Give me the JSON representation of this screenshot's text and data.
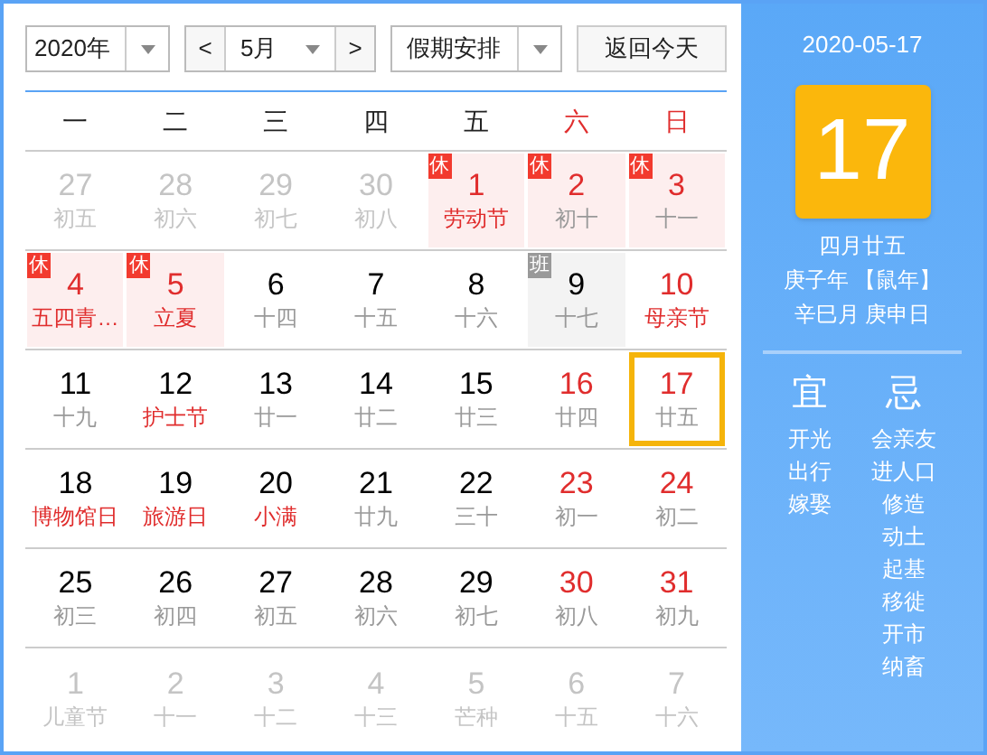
{
  "toolbar": {
    "year": "2020年",
    "month": "5月",
    "prev": "<",
    "next": ">",
    "holiday_select": "假期安排",
    "today_button": "返回今天"
  },
  "weekdays": [
    {
      "label": "一",
      "weekend": false
    },
    {
      "label": "二",
      "weekend": false
    },
    {
      "label": "三",
      "weekend": false
    },
    {
      "label": "四",
      "weekend": false
    },
    {
      "label": "五",
      "weekend": false
    },
    {
      "label": "六",
      "weekend": true
    },
    {
      "label": "日",
      "weekend": true
    }
  ],
  "days": [
    {
      "day": "27",
      "lunar": "初五",
      "kind": "muted",
      "festival": false,
      "selected": false
    },
    {
      "day": "28",
      "lunar": "初六",
      "kind": "muted",
      "festival": false,
      "selected": false
    },
    {
      "day": "29",
      "lunar": "初七",
      "kind": "muted",
      "festival": false,
      "selected": false
    },
    {
      "day": "30",
      "lunar": "初八",
      "kind": "muted",
      "festival": false,
      "selected": false
    },
    {
      "day": "1",
      "lunar": "劳动节",
      "kind": "red",
      "festival": true,
      "selected": false,
      "badge": {
        "kind": "rest",
        "text": "休"
      }
    },
    {
      "day": "2",
      "lunar": "初十",
      "kind": "red",
      "festival": false,
      "selected": false,
      "badge": {
        "kind": "rest",
        "text": "休"
      }
    },
    {
      "day": "3",
      "lunar": "十一",
      "kind": "red",
      "festival": false,
      "selected": false,
      "badge": {
        "kind": "rest",
        "text": "休"
      }
    },
    {
      "day": "4",
      "lunar": "五四青…",
      "kind": "red",
      "festival": true,
      "selected": false,
      "badge": {
        "kind": "rest",
        "text": "休"
      }
    },
    {
      "day": "5",
      "lunar": "立夏",
      "kind": "red",
      "festival": true,
      "selected": false,
      "badge": {
        "kind": "rest",
        "text": "休"
      }
    },
    {
      "day": "6",
      "lunar": "十四",
      "kind": "normal",
      "festival": false,
      "selected": false
    },
    {
      "day": "7",
      "lunar": "十五",
      "kind": "normal",
      "festival": false,
      "selected": false
    },
    {
      "day": "8",
      "lunar": "十六",
      "kind": "normal",
      "festival": false,
      "selected": false
    },
    {
      "day": "9",
      "lunar": "十七",
      "kind": "normal",
      "festival": false,
      "selected": false,
      "badge": {
        "kind": "work",
        "text": "班"
      }
    },
    {
      "day": "10",
      "lunar": "母亲节",
      "kind": "red",
      "festival": true,
      "selected": false
    },
    {
      "day": "11",
      "lunar": "十九",
      "kind": "normal",
      "festival": false,
      "selected": false
    },
    {
      "day": "12",
      "lunar": "护士节",
      "kind": "normal",
      "festival": true,
      "selected": false
    },
    {
      "day": "13",
      "lunar": "廿一",
      "kind": "normal",
      "festival": false,
      "selected": false
    },
    {
      "day": "14",
      "lunar": "廿二",
      "kind": "normal",
      "festival": false,
      "selected": false
    },
    {
      "day": "15",
      "lunar": "廿三",
      "kind": "normal",
      "festival": false,
      "selected": false
    },
    {
      "day": "16",
      "lunar": "廿四",
      "kind": "red",
      "festival": false,
      "selected": false
    },
    {
      "day": "17",
      "lunar": "廿五",
      "kind": "red",
      "festival": false,
      "selected": true
    },
    {
      "day": "18",
      "lunar": "博物馆日",
      "kind": "normal",
      "festival": true,
      "selected": false
    },
    {
      "day": "19",
      "lunar": "旅游日",
      "kind": "normal",
      "festival": true,
      "selected": false
    },
    {
      "day": "20",
      "lunar": "小满",
      "kind": "normal",
      "festival": true,
      "selected": false
    },
    {
      "day": "21",
      "lunar": "廿九",
      "kind": "normal",
      "festival": false,
      "selected": false
    },
    {
      "day": "22",
      "lunar": "三十",
      "kind": "normal",
      "festival": false,
      "selected": false
    },
    {
      "day": "23",
      "lunar": "初一",
      "kind": "red",
      "festival": false,
      "selected": false
    },
    {
      "day": "24",
      "lunar": "初二",
      "kind": "red",
      "festival": false,
      "selected": false
    },
    {
      "day": "25",
      "lunar": "初三",
      "kind": "normal",
      "festival": false,
      "selected": false
    },
    {
      "day": "26",
      "lunar": "初四",
      "kind": "normal",
      "festival": false,
      "selected": false
    },
    {
      "day": "27",
      "lunar": "初五",
      "kind": "normal",
      "festival": false,
      "selected": false
    },
    {
      "day": "28",
      "lunar": "初六",
      "kind": "normal",
      "festival": false,
      "selected": false
    },
    {
      "day": "29",
      "lunar": "初七",
      "kind": "normal",
      "festival": false,
      "selected": false
    },
    {
      "day": "30",
      "lunar": "初八",
      "kind": "red",
      "festival": false,
      "selected": false
    },
    {
      "day": "31",
      "lunar": "初九",
      "kind": "red",
      "festival": false,
      "selected": false
    },
    {
      "day": "1",
      "lunar": "儿童节",
      "kind": "muted",
      "festival": false,
      "selected": false
    },
    {
      "day": "2",
      "lunar": "十一",
      "kind": "muted",
      "festival": false,
      "selected": false
    },
    {
      "day": "3",
      "lunar": "十二",
      "kind": "muted",
      "festival": false,
      "selected": false
    },
    {
      "day": "4",
      "lunar": "十三",
      "kind": "muted",
      "festival": false,
      "selected": false
    },
    {
      "day": "5",
      "lunar": "芒种",
      "kind": "muted",
      "festival": false,
      "selected": false
    },
    {
      "day": "6",
      "lunar": "十五",
      "kind": "muted",
      "festival": false,
      "selected": false
    },
    {
      "day": "7",
      "lunar": "十六",
      "kind": "muted",
      "festival": false,
      "selected": false
    }
  ],
  "side_panel": {
    "date": "2020-05-17",
    "big_day": "17",
    "lunar_date": "四月廿五",
    "year_ganzhi": "庚子年 【鼠年】",
    "month_day_ganzhi": "辛巳月 庚申日",
    "good": {
      "title": "宜",
      "items": [
        "开光",
        "出行",
        "嫁娶"
      ]
    },
    "bad": {
      "title": "忌",
      "items": [
        "会亲友",
        "进人口",
        "修造",
        "动土",
        "起基",
        "移徙",
        "开市",
        "纳畜"
      ]
    }
  }
}
